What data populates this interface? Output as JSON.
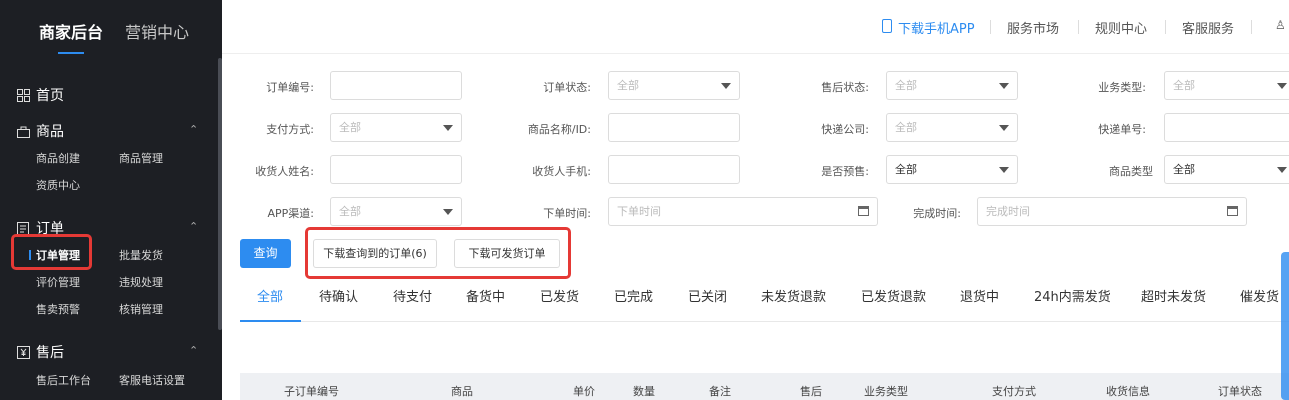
{
  "sidebar": {
    "tab_active": "商家后台",
    "tab_other": "营销中心",
    "home": "首页",
    "goods": {
      "title": "商品",
      "items": [
        "商品创建",
        "商品管理",
        "资质中心"
      ]
    },
    "orders": {
      "title": "订单",
      "items": [
        "订单管理",
        "批量发货",
        "评价管理",
        "违规处理",
        "售卖预警",
        "核销管理"
      ]
    },
    "aftersale": {
      "title": "售后",
      "items": [
        "售后工作台",
        "客服电话设置"
      ]
    }
  },
  "topbar": {
    "download_app": "下载手机APP",
    "service_market": "服务市场",
    "rules_center": "规则中心",
    "customer_service": "客服服务"
  },
  "filters": {
    "order_no_label": "订单编号:",
    "order_status_label": "订单状态:",
    "order_status_value": "全部",
    "aftersale_status_label": "售后状态:",
    "aftersale_status_value": "全部",
    "biz_type_label": "业务类型:",
    "biz_type_value": "全部",
    "pay_method_label": "支付方式:",
    "pay_method_value": "全部",
    "goods_name_label": "商品名称/ID:",
    "courier_label": "快递公司:",
    "courier_value": "全部",
    "tracking_label": "快递单号:",
    "receiver_name_label": "收货人姓名:",
    "receiver_phone_label": "收货人手机:",
    "presale_label": "是否预售:",
    "presale_value": "全部",
    "goods_type_label": "商品类型",
    "goods_type_value": "全部",
    "app_channel_label": "APP渠道:",
    "app_channel_value": "全部",
    "order_time_label": "下单时间:",
    "order_time_placeholder": "下单时间",
    "finish_time_label": "完成时间:",
    "finish_time_placeholder": "完成时间"
  },
  "actions": {
    "query": "查询",
    "download_queried": "下载查询到的订单(6)",
    "download_shippable": "下载可发货订单"
  },
  "tabs": [
    "全部",
    "待确认",
    "待支付",
    "备货中",
    "已发货",
    "已完成",
    "已关闭",
    "未发货退款",
    "已发货退款",
    "退货中",
    "24h内需发货",
    "超时未发货",
    "催发货"
  ],
  "table": {
    "headers": [
      "子订单编号",
      "商品",
      "单价",
      "数量",
      "备注",
      "售后",
      "业务类型",
      "支付方式",
      "收货信息",
      "订单状态"
    ]
  },
  "colors": {
    "accent": "#2d8cf0",
    "sidebar_bg": "#1d1f24",
    "highlight_red": "#e53935"
  }
}
